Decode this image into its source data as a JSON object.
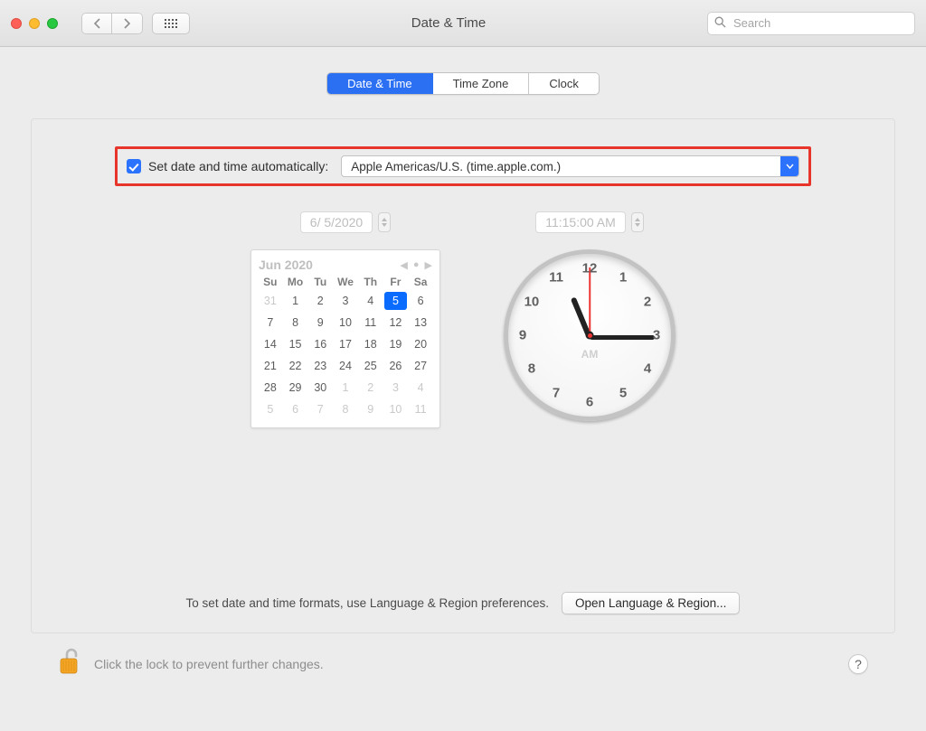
{
  "window": {
    "title": "Date & Time"
  },
  "toolbar": {
    "search_placeholder": "Search"
  },
  "tabs": {
    "date_time": "Date & Time",
    "time_zone": "Time Zone",
    "clock": "Clock"
  },
  "auto": {
    "label": "Set date and time automatically:",
    "server": "Apple Americas/U.S. (time.apple.com.)"
  },
  "date_field": "6/  5/2020",
  "time_field": "11:15:00 AM",
  "calendar": {
    "title": "Jun 2020",
    "dow": [
      "Su",
      "Mo",
      "Tu",
      "We",
      "Th",
      "Fr",
      "Sa"
    ],
    "cells": [
      {
        "v": "31",
        "out": true
      },
      {
        "v": "1"
      },
      {
        "v": "2"
      },
      {
        "v": "3"
      },
      {
        "v": "4"
      },
      {
        "v": "5",
        "sel": true
      },
      {
        "v": "6"
      },
      {
        "v": "7"
      },
      {
        "v": "8"
      },
      {
        "v": "9"
      },
      {
        "v": "10"
      },
      {
        "v": "11"
      },
      {
        "v": "12"
      },
      {
        "v": "13"
      },
      {
        "v": "14"
      },
      {
        "v": "15"
      },
      {
        "v": "16"
      },
      {
        "v": "17"
      },
      {
        "v": "18"
      },
      {
        "v": "19"
      },
      {
        "v": "20"
      },
      {
        "v": "21"
      },
      {
        "v": "22"
      },
      {
        "v": "23"
      },
      {
        "v": "24"
      },
      {
        "v": "25"
      },
      {
        "v": "26"
      },
      {
        "v": "27"
      },
      {
        "v": "28"
      },
      {
        "v": "29"
      },
      {
        "v": "30"
      },
      {
        "v": "1",
        "out": true
      },
      {
        "v": "2",
        "out": true
      },
      {
        "v": "3",
        "out": true
      },
      {
        "v": "4",
        "out": true
      },
      {
        "v": "5",
        "out": true
      },
      {
        "v": "6",
        "out": true
      },
      {
        "v": "7",
        "out": true
      },
      {
        "v": "8",
        "out": true
      },
      {
        "v": "9",
        "out": true
      },
      {
        "v": "10",
        "out": true
      },
      {
        "v": "11",
        "out": true
      }
    ]
  },
  "clock": {
    "numbers": [
      "12",
      "1",
      "2",
      "3",
      "4",
      "5",
      "6",
      "7",
      "8",
      "9",
      "10",
      "11"
    ],
    "ampm": "AM",
    "hour_angle": 247.5,
    "minute_angle": 0,
    "second_angle": 270
  },
  "footer": {
    "hint": "To set date and time formats, use Language & Region preferences.",
    "open_btn": "Open Language & Region..."
  },
  "lock_text": "Click the lock to prevent further changes.",
  "help": "?"
}
